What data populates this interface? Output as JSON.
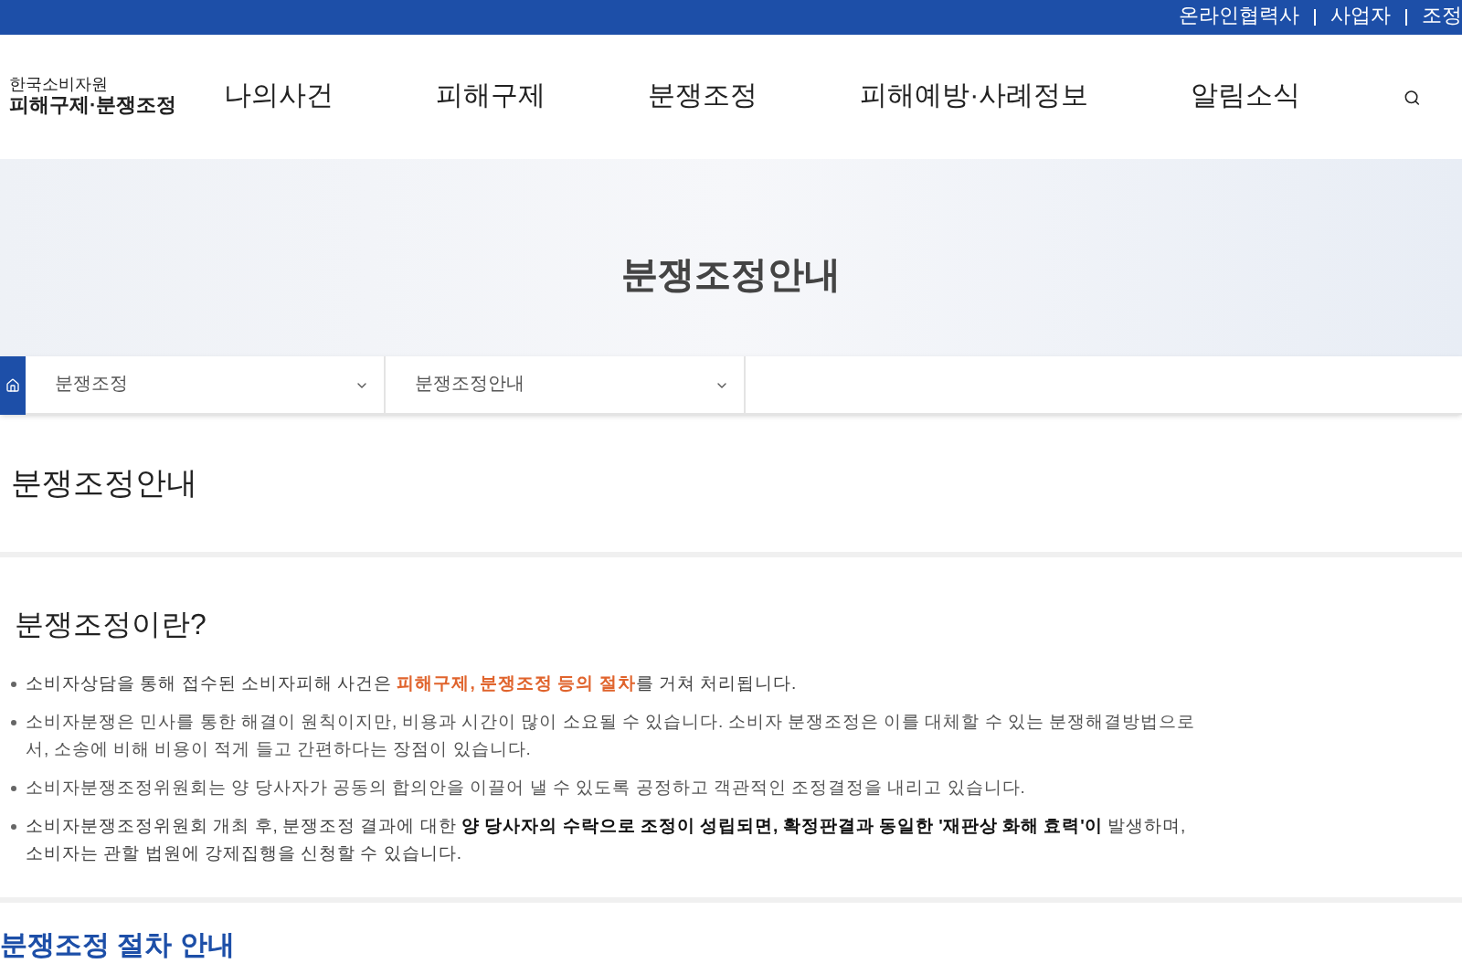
{
  "top_links": [
    "온라인협력사",
    "사업자",
    "조정"
  ],
  "logo": {
    "small": "한국소비자원",
    "main": "피해구제·분쟁조정"
  },
  "nav": [
    "나의사건",
    "피해구제",
    "분쟁조정",
    "피해예방·사례정보",
    "알림소식"
  ],
  "hero": {
    "title": "분쟁조정안내"
  },
  "breadcrumb": [
    "분쟁조정",
    "분쟁조정안내"
  ],
  "page_title": "분쟁조정안내",
  "section": {
    "heading": "분쟁조정이란?",
    "bullets": [
      {
        "text": "소비자상담을 통해 접수된 소비자피해 사건은 **피해구제, 분쟁조정 등의 절차**를 거쳐 처리됩니다.",
        "kind": "highlight"
      },
      {
        "text": "소비자분쟁은 민사를 통한 해결이 원칙이지만, 비용과 시간이 많이 소요될 수 있습니다. 소비자 분쟁조정은 이를 대체할 수 있는 분쟁해결방법으로서, 소송에 비해 비용이 적게 들고 간편하다는 장점이 있습니다.",
        "kind": "plain"
      },
      {
        "text": "소비자분쟁조정위원회는 양 당사자가 공동의 합의안을 이끌어 낼 수 있도록 공정하고 객관적인 조정결정을 내리고 있습니다.",
        "kind": "plain"
      },
      {
        "text": "소비자분쟁조정위원회 개최 후, 분쟁조정 결과에 대한 **양 당사자의 수락으로 조정이 성립되면, 확정판결과 동일한 '재판상 화해 효력'이** 발생하며, 소비자는 관할 법원에 강제집행을 신청할 수 있습니다.",
        "kind": "strong"
      }
    ]
  },
  "next_heading": "분쟁조정 절차 안내"
}
